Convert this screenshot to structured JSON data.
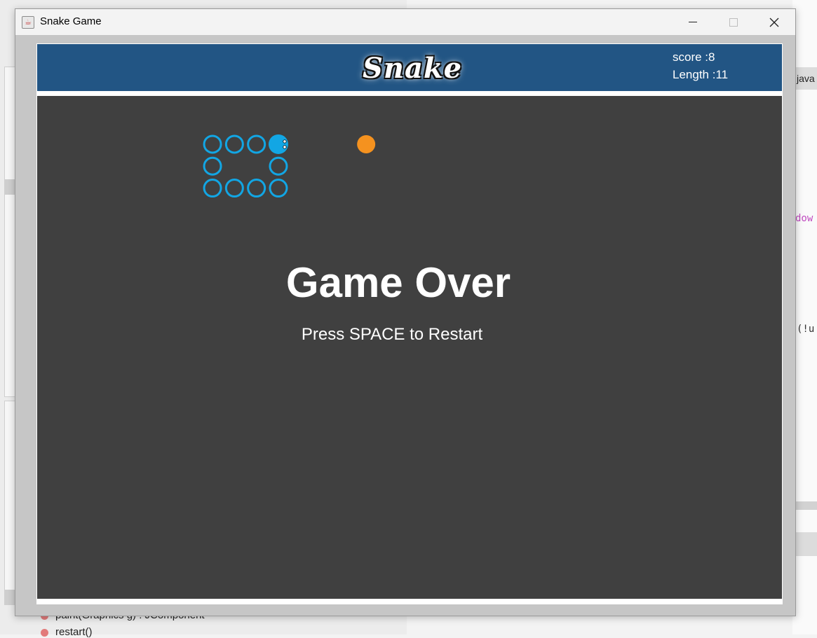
{
  "window": {
    "title": "Snake Game",
    "buttons": {
      "minimize": "minimize",
      "maximize": "maximize",
      "close": "close"
    }
  },
  "game": {
    "logo_text": "Snake",
    "score_text": "score :8",
    "length_text": "Length :11",
    "game_over_title": "Game Over",
    "restart_hint": "Press SPACE to Restart",
    "colors": {
      "header": "#225584",
      "board": "#404040",
      "snake": "#12a6e4",
      "food": "#f5921f"
    },
    "snake": {
      "head": {
        "col": 11,
        "row": 1
      },
      "body": [
        {
          "col": 10,
          "row": 1
        },
        {
          "col": 9,
          "row": 1
        },
        {
          "col": 8,
          "row": 1
        },
        {
          "col": 8,
          "row": 2
        },
        {
          "col": 8,
          "row": 3
        },
        {
          "col": 9,
          "row": 3
        },
        {
          "col": 10,
          "row": 3
        },
        {
          "col": 11,
          "row": 3
        },
        {
          "col": 11,
          "row": 2
        }
      ]
    },
    "food": {
      "col": 15,
      "row": 1
    }
  },
  "background": {
    "left_code": [
      "paint(Graphics g) : JComponent",
      "restart()"
    ],
    "right_tab": "java",
    "right_snippets": [
      "dow",
      "(!u"
    ]
  }
}
